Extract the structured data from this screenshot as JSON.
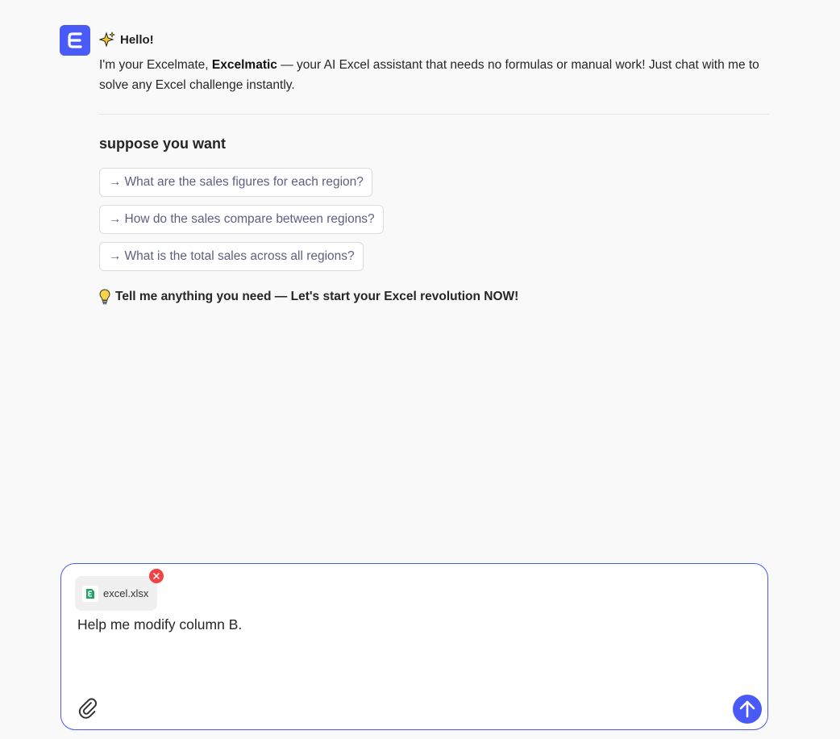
{
  "assistant": {
    "logo_icon": "excelmatic-e-logo-icon",
    "greeting_icon": "sparkles-icon",
    "greeting": "Hello!",
    "intro_prefix": "I'm your Excelmate, ",
    "intro_brand": "Excelmatic",
    "intro_suffix": " — your AI Excel assistant that needs no formulas or manual work! Just chat with me to solve any Excel challenge instantly.",
    "suggestions_title": "suppose you want",
    "suggestions": [
      {
        "arrow": "→",
        "label": "What are the sales figures for each region?"
      },
      {
        "arrow": "→",
        "label": "How do the sales compare between regions?"
      },
      {
        "arrow": "→",
        "label": "What is the total sales across all regions?"
      }
    ],
    "tip_icon": "lightbulb-icon",
    "tip": "Tell me anything you need — Let's start your Excel revolution NOW!"
  },
  "composer": {
    "attachment": {
      "file_name": "excel.xlsx",
      "file_icon": "excel-file-icon",
      "remove_icon": "close-icon"
    },
    "input_value": "Help me modify column B.",
    "attach_icon": "paperclip-icon",
    "send_icon": "arrow-up-icon"
  },
  "colors": {
    "accent": "#4a5af7",
    "remove": "#ef4444",
    "excel_green": "#21a366",
    "background": "#f9f9f9"
  }
}
